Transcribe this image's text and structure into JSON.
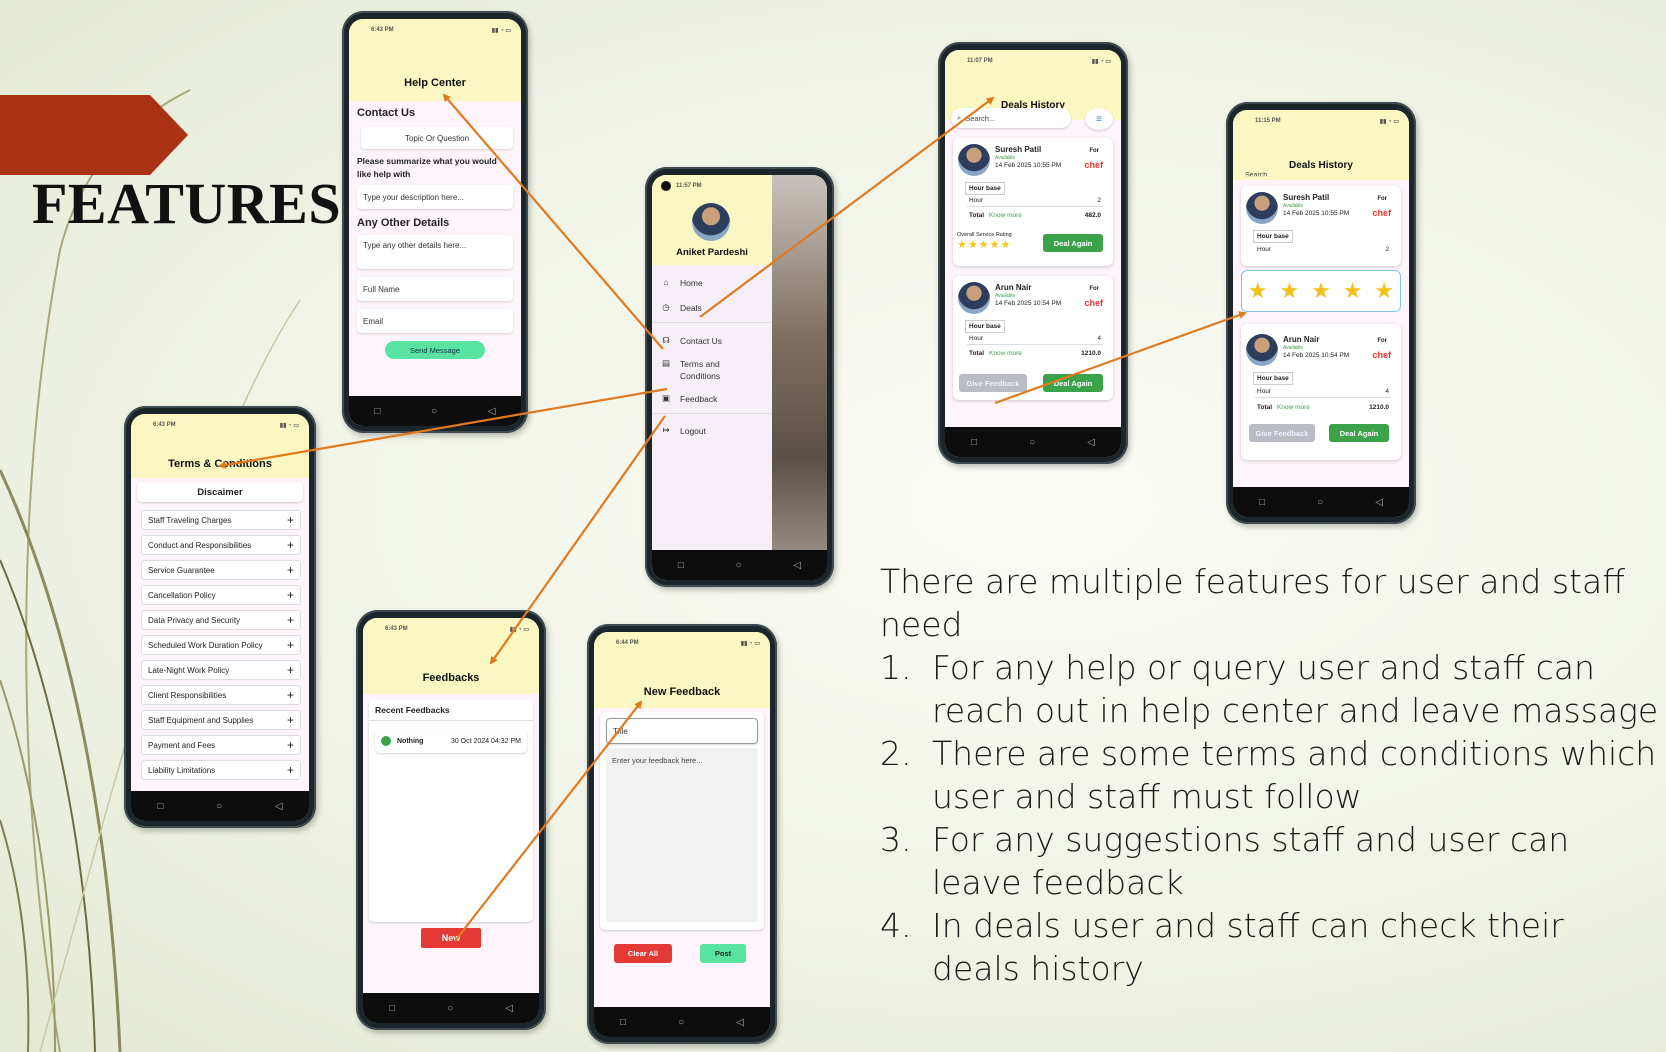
{
  "slide": {
    "title": "FEATURES",
    "intro": "There are multiple features for user and staff need",
    "points": [
      {
        "num": "1.",
        "text": "For any help or query user and staff can reach out in help center and leave massage"
      },
      {
        "num": "2.",
        "text": "There are some terms and conditions which user and staff must follow"
      },
      {
        "num": "3.",
        "text": "For any suggestions staff and user can leave feedback"
      },
      {
        "num": "4.",
        "text": "In deals user and staff can check their deals history"
      }
    ],
    "colors": {
      "banner": "#a93214",
      "arrows": "#e07a1f",
      "header_yellow": "#fbf7c2"
    }
  },
  "help_center": {
    "time": "6:43 PM",
    "title": "Help Center",
    "contact_us": "Contact Us",
    "topic_button": "Topic Or Question",
    "summary_label": "Please summarize what you would like help with",
    "description_placeholder": "Type your description here...",
    "other_details": "Any Other Details",
    "other_placeholder": "Type any other details here...",
    "full_name_placeholder": "Full Name",
    "email_placeholder": "Email",
    "send_button": "Send Message"
  },
  "terms": {
    "time": "6:43 PM",
    "title": "Terms & Conditions",
    "disclaimer": "Discaimer",
    "items": [
      "Staff Traveling Charges",
      "Conduct and Responsibilities",
      "Service Guarantee",
      "Cancellation Policy",
      "Data Privacy and Security",
      "Scheduled Work Duration Policy",
      "Late-Night Work Policy",
      "Client Responsibilities",
      "Staff Equipment and Supplies",
      "Payment and Fees",
      "Liability Limitations"
    ],
    "plus": "+"
  },
  "drawer": {
    "time": "11:57 PM",
    "user_name": "Aniket Pardeshi",
    "items": [
      {
        "icon": "home-icon",
        "glyph": "⌂",
        "label": "Home"
      },
      {
        "icon": "history-icon",
        "glyph": "◷",
        "label": "Deals"
      },
      {
        "icon": "headset-icon",
        "glyph": "☊",
        "label": "Contact Us"
      },
      {
        "icon": "document-icon",
        "glyph": "▤",
        "label": "Terms and Conditions"
      },
      {
        "icon": "feedback-icon",
        "glyph": "▣",
        "label": "Feedback"
      },
      {
        "icon": "logout-icon",
        "glyph": "↦",
        "label": "Logout"
      }
    ]
  },
  "feedbacks": {
    "time": "6:43 PM",
    "title": "Feedbacks",
    "recent_label": "Recent Feedbacks",
    "item_title": "Nothing",
    "item_date": "30 Oct 2024 04:32 PM",
    "new_button": "New"
  },
  "new_feedback": {
    "time": "6:44 PM",
    "title": "New Feedback",
    "title_placeholder": "Title",
    "body_placeholder": "Enter your feedback here...",
    "clear_button": "Clear All",
    "post_button": "Post"
  },
  "deals1": {
    "time": "11:07 PM",
    "title": "Deals History",
    "search_placeholder": "Search...",
    "deal_a": {
      "name": "Suresh Patil",
      "status": "Available",
      "date": "14 Feb 2025 10:55 PM",
      "for": "For",
      "role": "chef",
      "type": "Hour base",
      "hour_label": "Hour",
      "hours": "2",
      "total_label": "Total",
      "know_more": "Know more",
      "total": "482.0",
      "rating_label": "Overall Service Rating",
      "stars": "★★★★★",
      "button": "Deal Again"
    },
    "deal_b": {
      "name": "Arun Nair",
      "status": "Available",
      "date": "14 Feb 2025 10:54 PM",
      "for": "For",
      "role": "chef",
      "type": "Hour base",
      "hour_label": "Hour",
      "hours": "4",
      "total_label": "Total",
      "know_more": "Know more",
      "total": "1210.0",
      "feedback_button": "Give Feedback",
      "button": "Deal Again"
    }
  },
  "deals2": {
    "time": "11:15 PM",
    "title": "Deals History",
    "search_placeholder": "Search...",
    "deal_a": {
      "name": "Suresh Patil",
      "status": "Available",
      "date": "14 Feb 2025 10:55 PM",
      "for": "For",
      "role": "chef",
      "type": "Hour base",
      "hour_label": "Hour",
      "hours": "2"
    },
    "rating_stars": 5,
    "deal_b": {
      "name": "Arun Nair",
      "status": "Available",
      "date": "14 Feb 2025 10:54 PM",
      "for": "For",
      "role": "chef",
      "type": "Hour base",
      "hour_label": "Hour",
      "hours": "4",
      "total_label": "Total",
      "know_more": "Know more",
      "total": "1210.0",
      "feedback_button": "Give Feedback",
      "button": "Deal Again"
    }
  }
}
